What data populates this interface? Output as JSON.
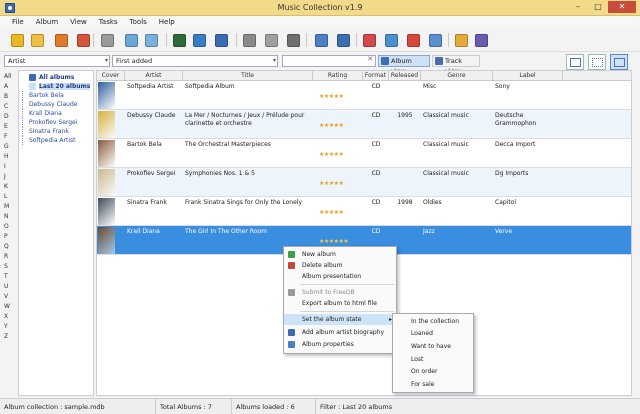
{
  "window": {
    "title": "Music Collection v1.9",
    "min": "–",
    "max": "□",
    "close": "✕"
  },
  "menu": [
    "File",
    "Album",
    "View",
    "Tasks",
    "Tools",
    "Help"
  ],
  "toolbar_icons": [
    {
      "name": "add-album-icon",
      "color": "#e8b923"
    },
    {
      "name": "search-album-icon",
      "color": "#f0c040"
    },
    {
      "name": "edit-album-icon",
      "color": "#e07b2a"
    },
    {
      "name": "delete-album-icon",
      "color": "#d4553b"
    },
    {
      "name": "download-icon",
      "color": "#9a9a9a"
    },
    {
      "name": "find-icon",
      "color": "#6aa7d8"
    },
    {
      "name": "web-search-icon",
      "color": "#7ab0dd"
    },
    {
      "name": "cover-icon",
      "color": "#2f6b3a"
    },
    {
      "name": "tracks-icon",
      "color": "#3a7bc8"
    },
    {
      "name": "folder-icon",
      "color": "#3c6bb6"
    },
    {
      "name": "print-icon",
      "color": "#8a8a8a"
    },
    {
      "name": "scanner-icon",
      "color": "#a0a0a0"
    },
    {
      "name": "export-icon",
      "color": "#6f6f6f"
    },
    {
      "name": "presentation-icon",
      "color": "#4b7ec2"
    },
    {
      "name": "magnifier-icon",
      "color": "#3d6fb0"
    },
    {
      "name": "calendar-icon",
      "color": "#d04a4a"
    },
    {
      "name": "notes-icon",
      "color": "#4c8fd0"
    },
    {
      "name": "statistics-icon",
      "color": "#d8483a"
    },
    {
      "name": "report-icon",
      "color": "#5b8fd0"
    },
    {
      "name": "users-icon",
      "color": "#e7a93a"
    },
    {
      "name": "books-icon",
      "color": "#6a5ab0"
    }
  ],
  "filter": {
    "field": "Artist",
    "sort": "First added",
    "search_value": "",
    "search_clear": "✕",
    "album_view": "Album view",
    "track_view": "Track view",
    "arrow": "▾"
  },
  "alphabet": [
    "All",
    "A",
    "B",
    "C",
    "D",
    "E",
    "F",
    "G",
    "H",
    "I",
    "J",
    "K",
    "L",
    "M",
    "N",
    "O",
    "P",
    "Q",
    "R",
    "S",
    "T",
    "U",
    "V",
    "W",
    "X",
    "Y",
    "Z"
  ],
  "tree": {
    "root1": "All albums",
    "root2": "Last 20 albums",
    "artists": [
      "Bartok Bela",
      "Debussy Claude",
      "Krall Diana",
      "Prokofiev Sergei",
      "Sinatra Frank",
      "Softpedia Artist"
    ]
  },
  "columns": [
    "Cover",
    "Artist",
    "Title",
    "Rating",
    "Format",
    "Released",
    "Genre",
    "Label"
  ],
  "rows": [
    {
      "artist": "Softpedia Artist",
      "title": "Softpedia Album",
      "rating": "★★★★★",
      "format": "CD",
      "released": "",
      "genre": "Misc",
      "label": "Sony",
      "cover": "#2f5d9c"
    },
    {
      "artist": "Debussy Claude",
      "title": "La Mer / Nocturnes / Jeux / Prélude pour clarinette et orchestre",
      "rating": "★★★★★",
      "format": "CD",
      "released": "1995",
      "genre": "Classical music",
      "label": "Deutsche Grammophon",
      "cover": "#d7b23a"
    },
    {
      "artist": "Bartok Bela",
      "title": "The Orchestral Masterpieces",
      "rating": "★★★★★",
      "format": "CD",
      "released": "",
      "genre": "Classical music",
      "label": "Decca Import",
      "cover": "#8a5a3a"
    },
    {
      "artist": "Prokofiev Sergei",
      "title": "Symphonies Nos. 1 & 5",
      "rating": "★★★★★",
      "format": "CD",
      "released": "",
      "genre": "Classical music",
      "label": "Dg Imports",
      "cover": "#c9b98a"
    },
    {
      "artist": "Sinatra Frank",
      "title": "Frank Sinatra Sings for Only the Lonely",
      "rating": "★★★★★",
      "format": "CD",
      "released": "1998",
      "genre": "Oldies",
      "label": "Capitol",
      "cover": "#3d4a5a"
    },
    {
      "artist": "Krall Diana",
      "title": "The Girl In The Other Room",
      "rating": "★★★★★★",
      "format": "CD",
      "released": "",
      "genre": "Jazz",
      "label": "Verve",
      "cover": "#6b4a2a"
    }
  ],
  "context_menu": {
    "new_album": "New album",
    "delete_album": "Delete album",
    "album_presentation": "Album presentation",
    "submit_freedb": "Submit to FreeDB",
    "export_html": "Export album to html file",
    "set_state": "Set the album state",
    "add_bio": "Add album artist biography",
    "album_properties": "Album properties",
    "arrow": "▸"
  },
  "submenu": [
    "In the collection",
    "Loaned",
    "Want to have",
    "Lost",
    "On order",
    "For sale"
  ],
  "status": {
    "collection": "Album collection : sample.mdb",
    "total": "Total Albums : 7",
    "loaded": "Albums loaded : 6",
    "filter": "Filter : Last 20 albums"
  }
}
